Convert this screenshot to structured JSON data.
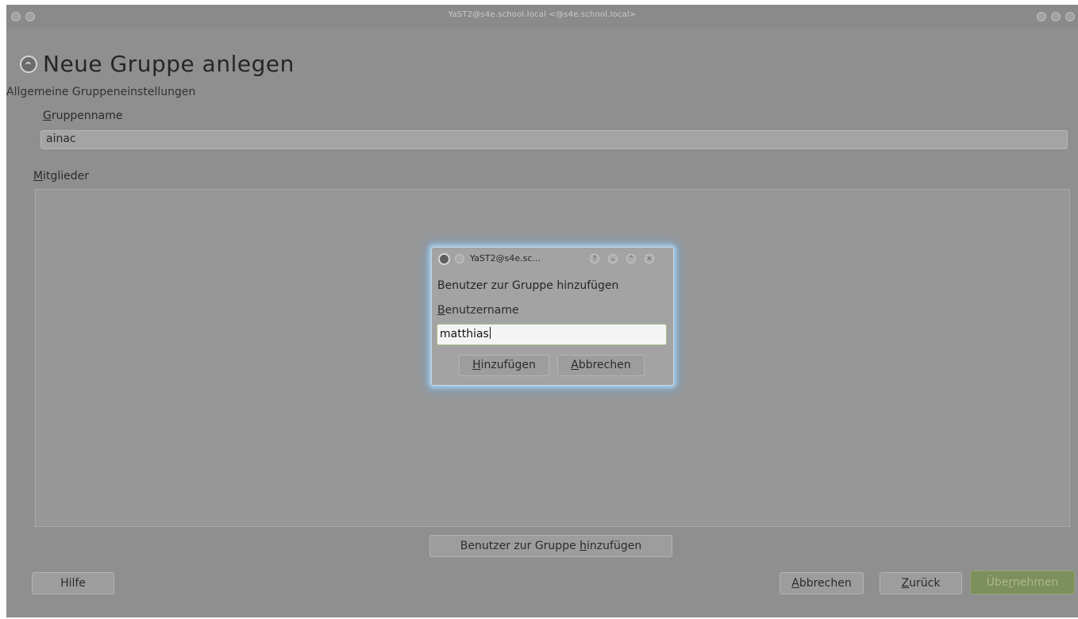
{
  "window": {
    "title": "YaST2@s4e.school.local <@s4e.school.local>"
  },
  "page": {
    "title": "Neue Gruppe anlegen",
    "subtitle": "Allgemeine Gruppeneinstellungen"
  },
  "group_name": {
    "label_accel": "G",
    "label_rest": "ruppenname",
    "value": "ainac"
  },
  "members": {
    "label_accel": "M",
    "label_rest": "itglieder",
    "items": []
  },
  "buttons": {
    "add_user_pre": "Benutzer zur Gruppe ",
    "add_user_accel": "h",
    "add_user_post": "inzufügen",
    "help": "Hilfe",
    "cancel_accel": "A",
    "cancel_rest": "bbrechen",
    "back_accel": "Z",
    "back_rest": "urück",
    "accept_pre": "Übe",
    "accept_accel": "r",
    "accept_post": "nehmen"
  },
  "dialog": {
    "title": "YaST2@s4e.sc...",
    "heading": "Benutzer zur Gruppe hinzufügen",
    "username_label_accel": "B",
    "username_label_rest": "enutzername",
    "username_value": "matthias",
    "add_accel": "H",
    "add_rest": "inzufügen",
    "cancel_accel": "A",
    "cancel_rest": "bbrechen"
  },
  "colors": {
    "background": "#8f8f8f",
    "accept_button": "#7d8f5a",
    "dialog_glow": "#aad2f0"
  }
}
